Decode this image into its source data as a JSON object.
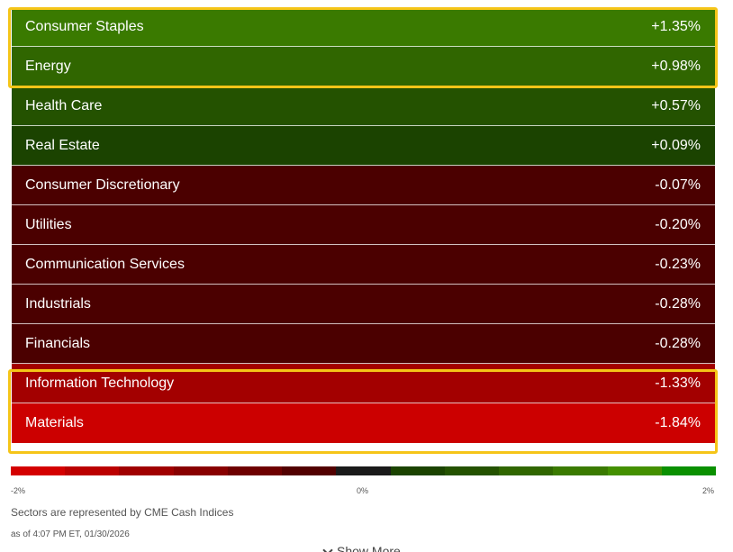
{
  "sectors": [
    {
      "name": "Consumer Staples",
      "change": "+1.35%",
      "color": "#3a7a00"
    },
    {
      "name": "Energy",
      "change": "+0.98%",
      "color": "#306600"
    },
    {
      "name": "Health Care",
      "change": "+0.57%",
      "color": "#245200"
    },
    {
      "name": "Real Estate",
      "change": "+0.09%",
      "color": "#1b4300"
    },
    {
      "name": "Consumer Discretionary",
      "change": "-0.07%",
      "color": "#4b0000"
    },
    {
      "name": "Utilities",
      "change": "-0.20%",
      "color": "#4b0000"
    },
    {
      "name": "Communication Services",
      "change": "-0.23%",
      "color": "#4b0000"
    },
    {
      "name": "Industrials",
      "change": "-0.28%",
      "color": "#4b0000"
    },
    {
      "name": "Financials",
      "change": "-0.28%",
      "color": "#4b0000"
    },
    {
      "name": "Information Technology",
      "change": "-1.33%",
      "color": "#a30000"
    },
    {
      "name": "Materials",
      "change": "-1.84%",
      "color": "#cc0000"
    }
  ],
  "scale": {
    "min_label": "-2%",
    "mid_label": "0%",
    "max_label": "2%",
    "colors": [
      "#d40000",
      "#bb0000",
      "#a00000",
      "#880000",
      "#6e0000",
      "#520000",
      "#1a1a1a",
      "#1b4300",
      "#245200",
      "#306600",
      "#3a7a00",
      "#449000",
      "#0a9000"
    ]
  },
  "note": "Sectors are represented by CME Cash Indices",
  "timestamp": "as of 4:07 PM ET, 01/30/2026",
  "show_more_label": "Show More",
  "highlight_color": "#f5c518"
}
